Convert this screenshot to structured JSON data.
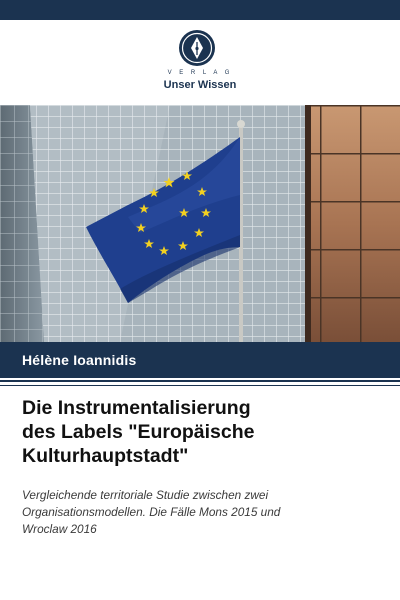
{
  "publisher": {
    "label_small": "V E R L A G",
    "name": "Unser Wissen"
  },
  "colors": {
    "brand_navy": "#1b3350",
    "flag_blue": "#1f3f8e",
    "flag_star": "#f2d021"
  },
  "cover": {
    "author": "Hélène Ioannidis",
    "title_lines": [
      "Die Instrumentalisierung",
      "des Labels \"Europäische",
      "Kulturhauptstadt\""
    ],
    "subtitle_lines": [
      "Vergleichende territoriale Studie zwischen zwei",
      "Organisationsmodellen. Die Fälle Mons 2015 und",
      "Wroclaw 2016"
    ]
  },
  "photo": {
    "subject": "eu-flag-in-front-of-glass-office-buildings",
    "flag_star_count": 12
  }
}
